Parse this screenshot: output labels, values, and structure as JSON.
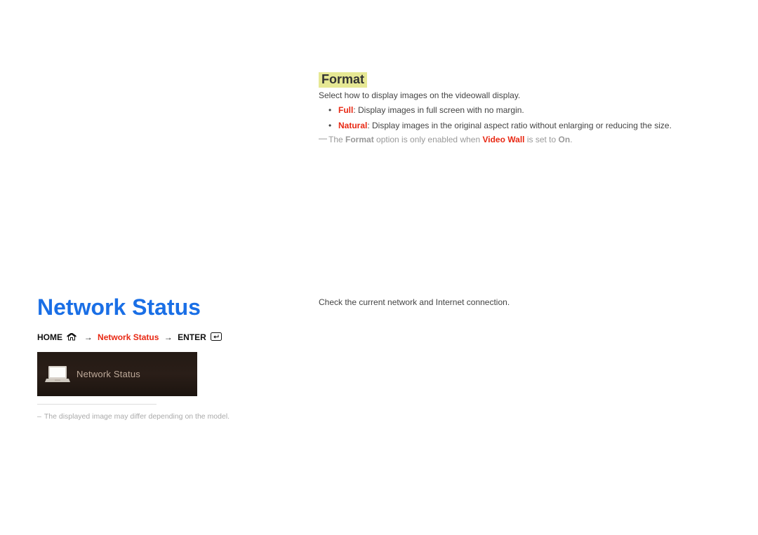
{
  "section1": {
    "heading": "Format",
    "description": "Select how to display images on the videowall display.",
    "bullets": [
      {
        "strong": "Full",
        "text": ": Display images in full screen with no margin."
      },
      {
        "strong": "Natural",
        "text": ": Display images in the original aspect ratio without enlarging or reducing the size."
      }
    ],
    "note": {
      "prefix": "The ",
      "format": "Format",
      "mid": " option is only enabled when ",
      "video_wall": "Video Wall",
      "mid2": " is set to ",
      "on": "On",
      "suffix": "."
    }
  },
  "section2": {
    "title": "Network Status",
    "description": "Check the current network and Internet connection.",
    "nav": {
      "home": "HOME",
      "arrow": "→",
      "item": "Network Status",
      "enter": "ENTER"
    },
    "tile_label": "Network Status",
    "small_note": "The displayed image may differ depending on the model."
  }
}
